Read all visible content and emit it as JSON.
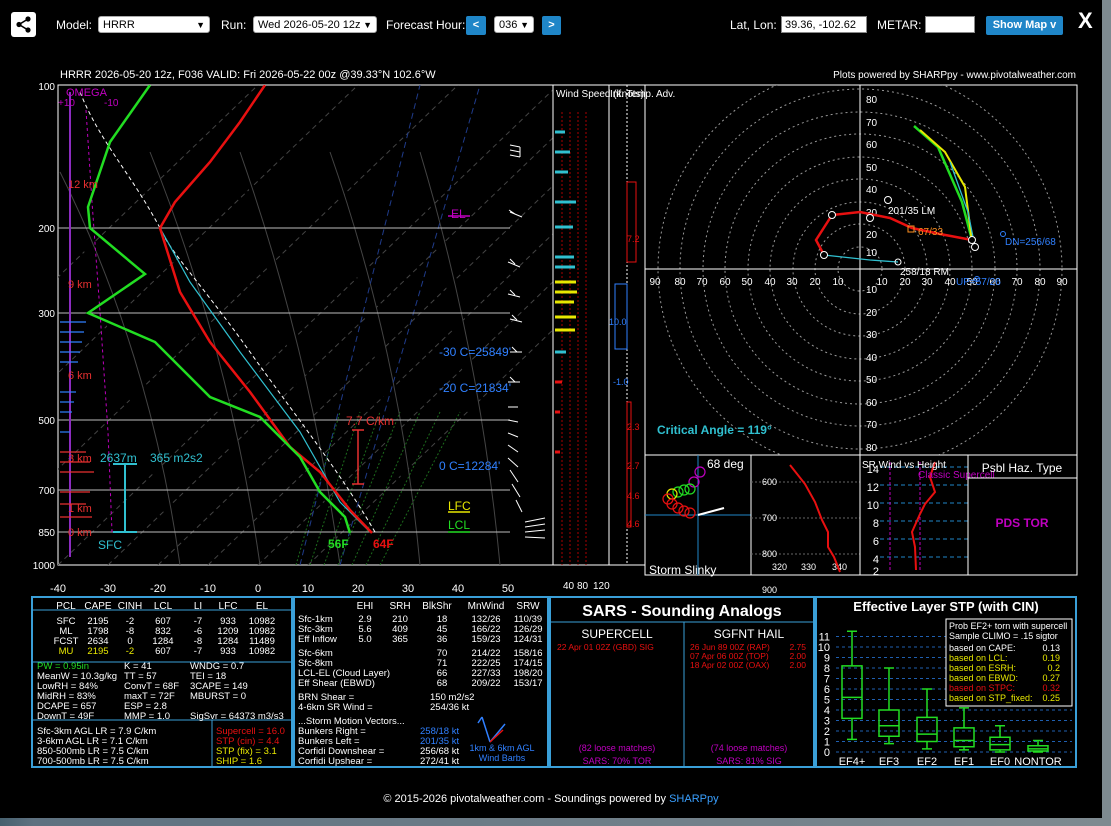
{
  "header": {
    "model_label": "Model:",
    "model_value": "HRRR",
    "run_label": "Run:",
    "run_value": "Wed 2026-05-20 12z",
    "fhour_label": "Forecast Hour:",
    "prev_btn": "<",
    "fhour_value": "036",
    "next_btn": ">",
    "latlon_label": "Lat, Lon:",
    "latlon_value": "39.36, -102.62",
    "metar_label": "METAR:",
    "metar_value": "",
    "show_map": "Show Map v",
    "close": "X"
  },
  "sounding": {
    "title": "HRRR 2026-05-20 12z, F036   VALID: Fri 2026-05-22 00z @39.33°N 102.6°W",
    "credit": "Plots powered by SHARPpy - www.pivotalweather.com",
    "pressure_levels": [
      "100",
      "200",
      "300",
      "500",
      "700",
      "850",
      "1000"
    ],
    "temp_ticks": [
      "-40",
      "-30",
      "-20",
      "-10",
      "0",
      "10",
      "20",
      "30",
      "40",
      "50"
    ],
    "height_labels": [
      "12 km",
      "9 km",
      "6 km",
      "3 km",
      "1 km",
      "0 km"
    ],
    "omega": "OMEGA",
    "omega_ticks": [
      "+10",
      "-10"
    ],
    "el": "EL",
    "lfc": "LFC",
    "lcl": "LCL",
    "lapse": "7.7 C/km",
    "sfc": "SFC",
    "eff_depth": "2637m",
    "eff_srh": "365 m2s2",
    "temp_sfc": "64F",
    "dew_sfc": "56F",
    "iso_m30": "-30 C=25849'",
    "iso_m20": "-20 C=21834'",
    "iso_0": "0 C=12284'",
    "wind_speed_header": "Wind Speed (knots)",
    "inf_temp_header": "Inf. Temp. Adv.",
    "ws_ticks": [
      "40",
      "80",
      "120"
    ],
    "adv_values": [
      "7.2",
      "10.0",
      "-1.0",
      "2.3",
      "2.7",
      "4.6",
      "4.6"
    ],
    "hodo_rings": [
      "10",
      "20",
      "30",
      "40",
      "50",
      "60",
      "70",
      "80"
    ],
    "hodo_axis": [
      "90",
      "80",
      "70",
      "60",
      "50",
      "40",
      "30",
      "20",
      "10",
      "10",
      "20",
      "30",
      "40",
      "50",
      "60",
      "70",
      "80",
      "90"
    ],
    "hodo_lm": "201/35 LM",
    "hodo_rm": "258/18 RM",
    "hodo_dn": "DN=256/68",
    "hodo_up": "UP=57/26",
    "hodo_mean": "67/33",
    "critical_angle": "Critical Angle = 119°",
    "slinky_deg": "68 deg",
    "slinky_label": "Storm Slinky",
    "theta_ticks": [
      "600",
      "700",
      "800",
      "900"
    ],
    "theta_x": [
      "320",
      "330",
      "340"
    ],
    "srwind_label": "SR Wind vs Height",
    "classic_sc": "Classic Supercell",
    "srw_ticks": [
      "14",
      "12",
      "10",
      "8",
      "6",
      "4",
      "2"
    ],
    "psbl_title": "Psbl Haz. Type",
    "psbl_value": "PDS TOR"
  },
  "parcels": {
    "headers": [
      "PCL",
      "CAPE",
      "CINH",
      "LCL",
      "LI",
      "LFC",
      "EL"
    ],
    "rows": [
      [
        "SFC",
        "2195",
        "-2",
        "607",
        "-7",
        "933",
        "10982"
      ],
      [
        "ML",
        "1798",
        "-8",
        "832",
        "-6",
        "1209",
        "10982"
      ],
      [
        "FCST",
        "2634",
        "0",
        "1284",
        "-8",
        "1284",
        "11489"
      ],
      [
        "MU",
        "2195",
        "-2",
        "607",
        "-7",
        "933",
        "10982"
      ]
    ]
  },
  "indices_col1": [
    "PW = 0.95in",
    "MeanW = 10.3g/kg",
    "LowRH = 84%",
    "MidRH = 83%",
    "DCAPE = 657",
    "DownT = 49F"
  ],
  "indices_col2": [
    "K = 41",
    "TT = 57",
    "ConvT = 68F",
    "maxT = 72F",
    "ESP = 2.8",
    "MMP = 1.0"
  ],
  "indices_col3": [
    "WNDG = 0.7",
    "TEI = 18",
    "3CAPE = 149",
    "MBURST = 0",
    "",
    "SigSvr = 64373 m3/s3"
  ],
  "lapse_rates": [
    "Sfc-3km AGL LR = 7.9 C/km",
    "3-6km AGL LR = 7.1 C/km",
    "850-500mb LR = 7.5 C/km",
    "700-500mb LR = 7.5 C/km"
  ],
  "composites": [
    "Supercell = 16.0",
    "STP (cin) = 4.4",
    "STP (fix) = 3.1",
    "SHIP = 1.6"
  ],
  "kinematics": {
    "headers": [
      "EHI",
      "SRH",
      "BlkShr",
      "MnWind",
      "SRW"
    ],
    "rows": [
      [
        "Sfc-1km",
        "2.9",
        "210",
        "18",
        "132/26",
        "110/39"
      ],
      [
        "Sfc-3km",
        "5.6",
        "409",
        "45",
        "166/22",
        "126/29"
      ],
      [
        "Eff Inflow",
        "5.0",
        "365",
        "36",
        "159/23",
        "124/31"
      ],
      [
        "Sfc-6km",
        "",
        "",
        "70",
        "214/22",
        "158/16"
      ],
      [
        "Sfc-8km",
        "",
        "",
        "71",
        "222/25",
        "174/15"
      ],
      [
        "LCL-EL (Cloud Layer)",
        "",
        "",
        "66",
        "227/33",
        "198/20"
      ],
      [
        "Eff Shear (EBWD)",
        "",
        "",
        "68",
        "209/22",
        "153/17"
      ]
    ],
    "brn": [
      "BRN Shear =",
      "150 m2/s2"
    ],
    "sr46": [
      "4-6km SR Wind =",
      "254/36 kt"
    ],
    "motion_title": "...Storm Motion Vectors...",
    "motion": [
      [
        "Bunkers Right =",
        "258/18 kt"
      ],
      [
        "Bunkers Left =",
        "201/35 kt"
      ],
      [
        "Corfidi Downshear =",
        "256/68 kt"
      ],
      [
        "Corfidi Upshear =",
        "272/41 kt"
      ]
    ],
    "barb_label": [
      "1km & 6km AGL",
      "Wind Barbs"
    ]
  },
  "sars": {
    "title": "SARS - Sounding Analogs",
    "supercell": "SUPERCELL",
    "hail": "SGFNT HAIL",
    "sc_matches": [
      "22 Apr 01 02Z (GBD)   SIG"
    ],
    "hail_matches": [
      [
        "26 Jun 89 00Z (RAP)",
        "2.75"
      ],
      [
        "07 Apr 06 00Z (TOP)",
        "2.00"
      ],
      [
        "18 Apr 02 00Z (OAX)",
        "2.00"
      ]
    ],
    "sc_loose": "(82 loose matches)",
    "sc_pct": "SARS: 70% TOR",
    "hail_loose": "(74 loose matches)",
    "hail_pct": "SARS: 81% SIG"
  },
  "stp": {
    "title": "Effective Layer STP (with CIN)",
    "yticks": [
      "0",
      "1",
      "2",
      "3",
      "4",
      "5",
      "6",
      "7",
      "8",
      "9",
      "10",
      "11"
    ],
    "cats": [
      "EF4+",
      "EF3",
      "EF2",
      "EF1",
      "EF0",
      "NONTOR"
    ],
    "legend_title": [
      "Prob EF2+ torn with supercell",
      "Sample CLIMO = .15 sigtor"
    ],
    "legend_rows": [
      [
        "based on CAPE:",
        "0.13"
      ],
      [
        "based on LCL:",
        "0.19"
      ],
      [
        "based on ESRH:",
        "0.2"
      ],
      [
        "based on EBWD:",
        "0.27"
      ],
      [
        "based on STPC:",
        "0.32"
      ],
      [
        "based on STP_fixed:",
        "0.25"
      ]
    ]
  },
  "footer": {
    "text": "© 2015-2026 pivotalweather.com - Soundings powered by ",
    "link": "SHARPpy"
  }
}
